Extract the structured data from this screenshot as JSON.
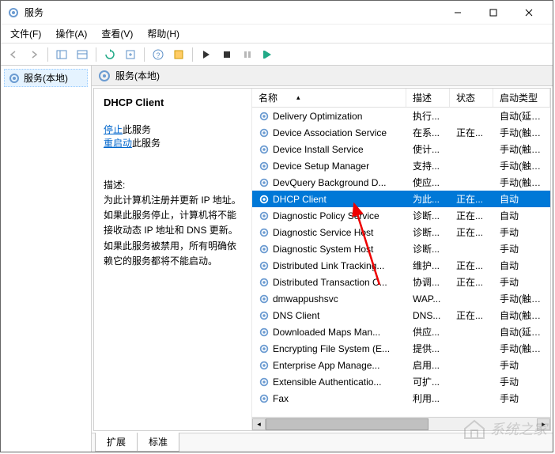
{
  "window": {
    "title": "服务"
  },
  "menu": {
    "file": "文件(F)",
    "action": "操作(A)",
    "view": "查看(V)",
    "help": "帮助(H)"
  },
  "left": {
    "node": "服务(本地)"
  },
  "right_header": "服务(本地)",
  "detail": {
    "name": "DHCP Client",
    "stop_link": "停止",
    "stop_suffix": "此服务",
    "restart_link": "重启动",
    "restart_suffix": "此服务",
    "desc_label": "描述:",
    "desc_text": "为此计算机注册并更新 IP 地址。如果此服务停止，计算机将不能接收动态 IP 地址和 DNS 更新。如果此服务被禁用，所有明确依赖它的服务都将不能启动。"
  },
  "columns": {
    "name": "名称",
    "desc": "描述",
    "status": "状态",
    "start": "启动类型"
  },
  "services": [
    {
      "name": "Delivery Optimization",
      "desc": "执行...",
      "status": "",
      "start": "自动(延迟..."
    },
    {
      "name": "Device Association Service",
      "desc": "在系...",
      "status": "正在...",
      "start": "手动(触发..."
    },
    {
      "name": "Device Install Service",
      "desc": "使计...",
      "status": "",
      "start": "手动(触发..."
    },
    {
      "name": "Device Setup Manager",
      "desc": "支持...",
      "status": "",
      "start": "手动(触发..."
    },
    {
      "name": "DevQuery Background D...",
      "desc": "使应...",
      "status": "",
      "start": "手动(触发..."
    },
    {
      "name": "DHCP Client",
      "desc": "为此...",
      "status": "正在...",
      "start": "自动",
      "selected": true
    },
    {
      "name": "Diagnostic Policy Service",
      "desc": "诊断...",
      "status": "正在...",
      "start": "自动"
    },
    {
      "name": "Diagnostic Service Host",
      "desc": "诊断...",
      "status": "正在...",
      "start": "手动"
    },
    {
      "name": "Diagnostic System Host",
      "desc": "诊断...",
      "status": "",
      "start": "手动"
    },
    {
      "name": "Distributed Link Tracking...",
      "desc": "维护...",
      "status": "正在...",
      "start": "自动"
    },
    {
      "name": "Distributed Transaction C...",
      "desc": "协调...",
      "status": "正在...",
      "start": "手动"
    },
    {
      "name": "dmwappushsvc",
      "desc": "WAP...",
      "status": "",
      "start": "手动(触发..."
    },
    {
      "name": "DNS Client",
      "desc": "DNS...",
      "status": "正在...",
      "start": "自动(触发..."
    },
    {
      "name": "Downloaded Maps Man...",
      "desc": "供应...",
      "status": "",
      "start": "自动(延迟..."
    },
    {
      "name": "Encrypting File System (E...",
      "desc": "提供...",
      "status": "",
      "start": "手动(触发..."
    },
    {
      "name": "Enterprise App Manage...",
      "desc": "启用...",
      "status": "",
      "start": "手动"
    },
    {
      "name": "Extensible Authenticatio...",
      "desc": "可扩...",
      "status": "",
      "start": "手动"
    },
    {
      "name": "Fax",
      "desc": "利用...",
      "status": "",
      "start": "手动"
    }
  ],
  "tabs": {
    "extended": "扩展",
    "standard": "标准"
  },
  "watermark": "系统之家"
}
